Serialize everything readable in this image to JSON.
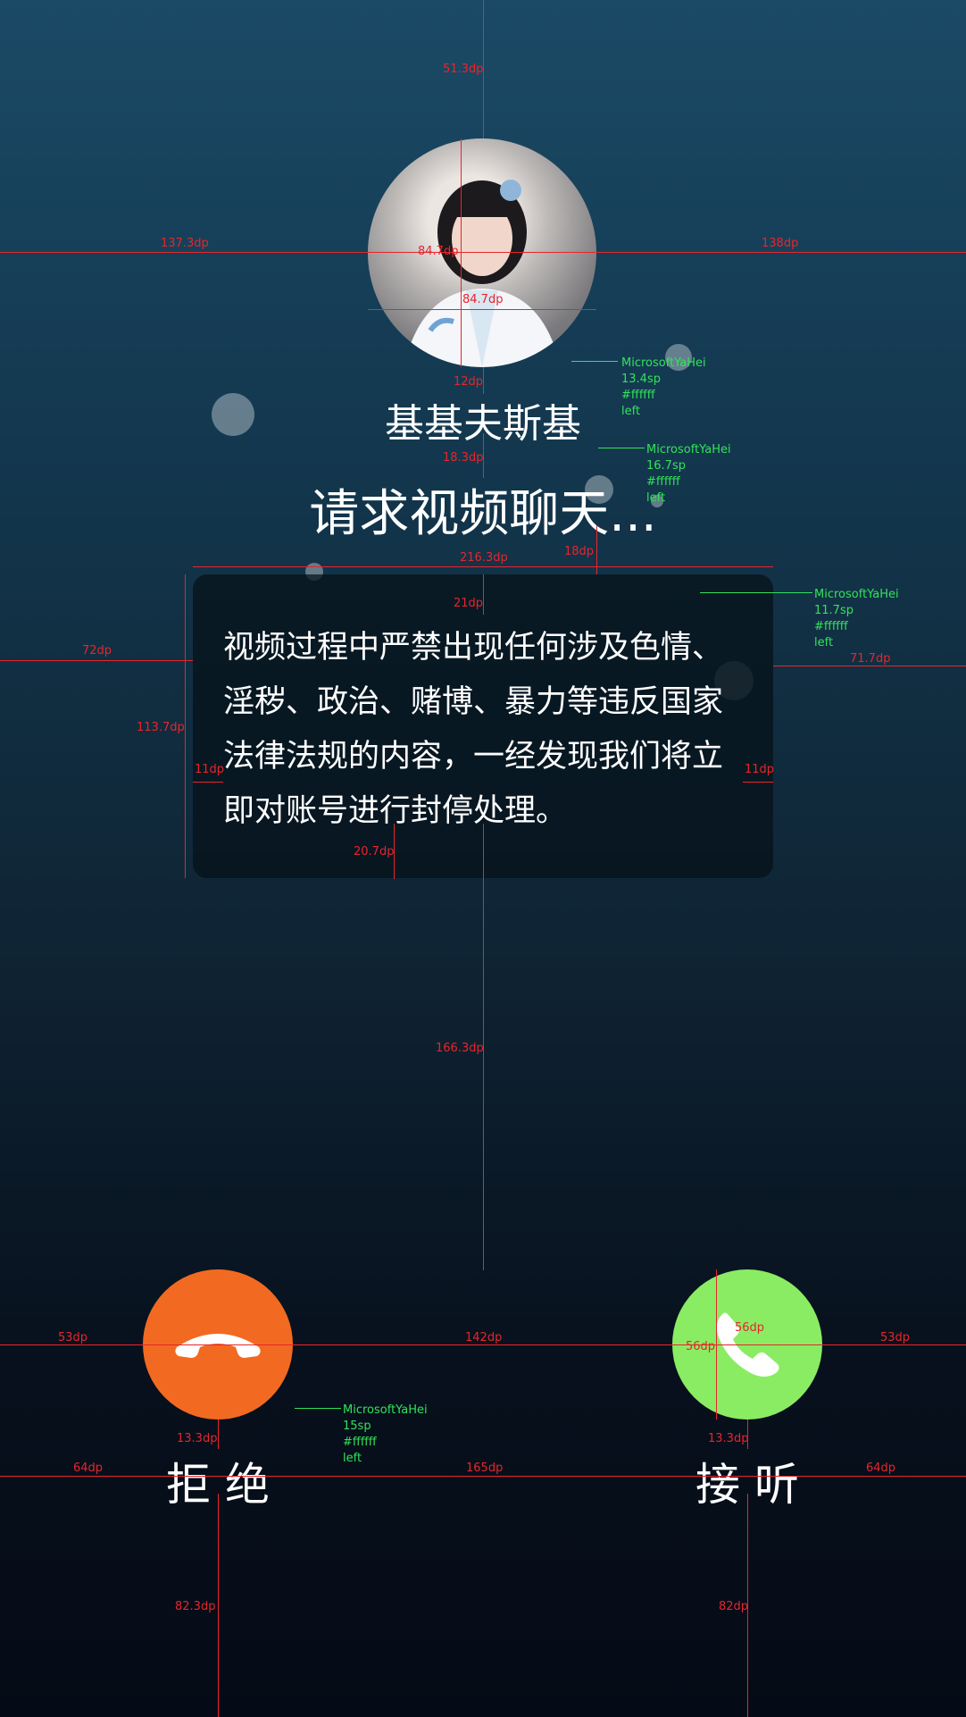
{
  "call": {
    "caller_name": "基基夫斯基",
    "status_text": "请求视频聊天...",
    "notice": "视频过程中严禁出现任何涉及色情、淫秽、政治、赌博、暴力等违反国家法律法规的内容，一经发现我们将立即对账号进行封停处理。",
    "reject_label": "拒 绝",
    "accept_label": "接 听"
  },
  "annotations": {
    "dims": [
      {
        "id": "d1",
        "text": "51.3dp"
      },
      {
        "id": "d2",
        "text": "137.3dp"
      },
      {
        "id": "d3",
        "text": "84.7dp"
      },
      {
        "id": "d4",
        "text": "84.7dp"
      },
      {
        "id": "d5",
        "text": "138dp"
      },
      {
        "id": "d6",
        "text": "12dp"
      },
      {
        "id": "d7",
        "text": "18.3dp"
      },
      {
        "id": "d8",
        "text": "18dp"
      },
      {
        "id": "d9",
        "text": "216.3dp"
      },
      {
        "id": "d10",
        "text": "21dp"
      },
      {
        "id": "d11",
        "text": "72dp"
      },
      {
        "id": "d12",
        "text": "71.7dp"
      },
      {
        "id": "d13",
        "text": "113.7dp"
      },
      {
        "id": "d14",
        "text": "11dp"
      },
      {
        "id": "d15",
        "text": "11dp"
      },
      {
        "id": "d16",
        "text": "20.7dp"
      },
      {
        "id": "d17",
        "text": "166.3dp"
      },
      {
        "id": "d18",
        "text": "53dp"
      },
      {
        "id": "d19",
        "text": "142dp"
      },
      {
        "id": "d20",
        "text": "56dp"
      },
      {
        "id": "d21",
        "text": "56dp"
      },
      {
        "id": "d22",
        "text": "53dp"
      },
      {
        "id": "d23",
        "text": "13.3dp"
      },
      {
        "id": "d24",
        "text": "13.3dp"
      },
      {
        "id": "d25",
        "text": "64dp"
      },
      {
        "id": "d26",
        "text": "165dp"
      },
      {
        "id": "d27",
        "text": "64dp"
      },
      {
        "id": "d28",
        "text": "82.3dp"
      },
      {
        "id": "d29",
        "text": "82dp"
      }
    ],
    "font_notes": [
      {
        "font": "MicrosoftYaHei",
        "size": "13.4sp",
        "color": "#ffffff",
        "align": "left"
      },
      {
        "font": "MicrosoftYaHei",
        "size": "16.7sp",
        "color": "#ffffff",
        "align": "left"
      },
      {
        "font": "MicrosoftYaHei",
        "size": "11.7sp",
        "color": "#ffffff",
        "align": "left"
      },
      {
        "font": "MicrosoftYaHei",
        "size": "15sp",
        "color": "#ffffff",
        "align": "left"
      }
    ]
  },
  "colors": {
    "reject": "#f26a21",
    "accept": "#8aec63",
    "text": "#ffffff"
  }
}
